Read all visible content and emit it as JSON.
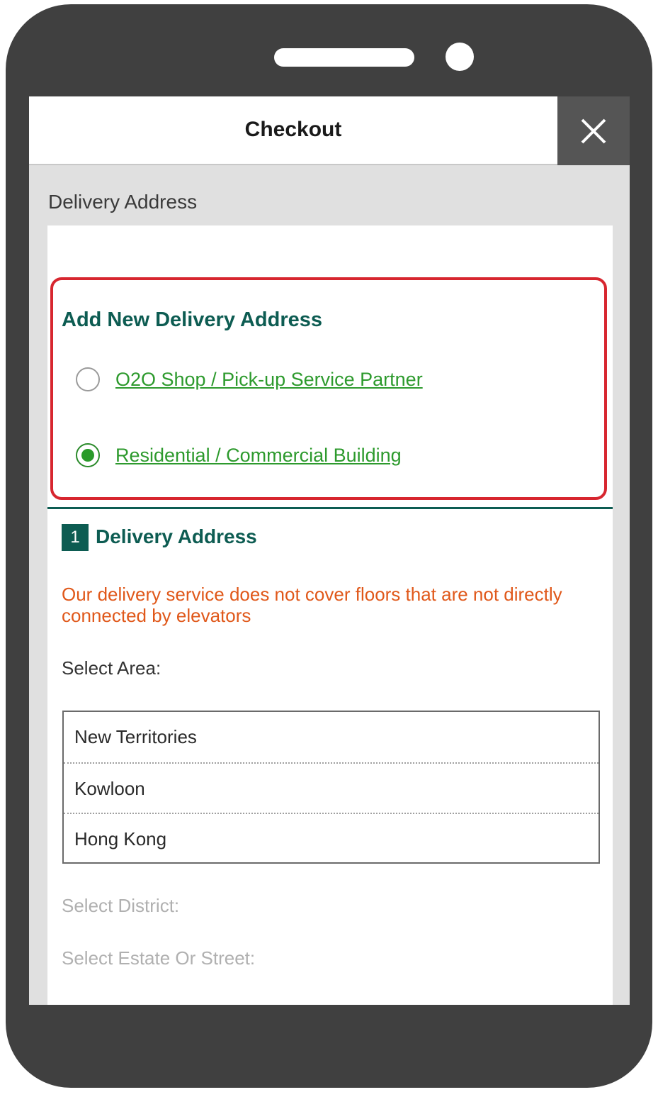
{
  "header": {
    "title": "Checkout",
    "close_icon": "close-icon"
  },
  "section_heading": "Delivery Address",
  "add_address": {
    "title": "Add New Delivery Address",
    "options": [
      {
        "label": "O2O Shop / Pick-up Service Partner",
        "selected": false
      },
      {
        "label": "Residential / Commercial Building",
        "selected": true
      }
    ]
  },
  "step": {
    "number": "1",
    "title": "Delivery Address"
  },
  "notice": "Our delivery service does not cover floors that are not directly connected by elevators",
  "area": {
    "label": "Select Area:",
    "options": [
      "New Territories",
      "Kowloon",
      "Hong Kong"
    ]
  },
  "district_label": "Select District:",
  "estate_label": "Select Estate Or Street:",
  "colors": {
    "accent_green": "#0d5c52",
    "link_green": "#2d9a2d",
    "notice_orange": "#e0581a",
    "highlight_red": "#d7262f"
  }
}
